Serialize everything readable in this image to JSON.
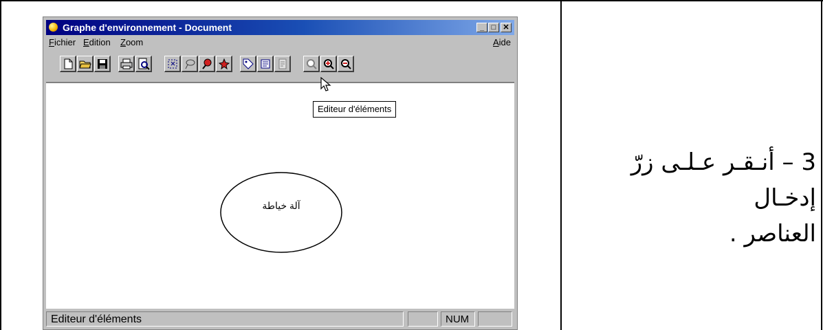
{
  "window": {
    "title": "Graphe d'environnement - Document",
    "controls": {
      "minimize": "_",
      "maximize": "□",
      "close": "✕"
    }
  },
  "menu": {
    "items": [
      "Fichier",
      "Edition",
      "Zoom"
    ],
    "help": "Aide"
  },
  "toolbar": {
    "buttons": [
      "new-file-icon",
      "open-folder-icon",
      "save-icon",
      "print-icon",
      "print-preview-icon",
      "select-tool-icon",
      "lasso-icon",
      "pin-red-icon",
      "star-pin-icon",
      "tag-icon",
      "element-editor-icon",
      "text-page-icon",
      "zoom-fit-icon",
      "zoom-in-icon",
      "zoom-out-icon"
    ]
  },
  "canvas": {
    "tooltip": "Editeur d'éléments",
    "node_label": "آلة خياطة"
  },
  "status": {
    "text": "Editeur d'éléments",
    "num": "NUM"
  },
  "instruction": {
    "line1": "3  –  أنـقـر عـلـى زرّ إدخـال",
    "line2": "العناصر ."
  }
}
